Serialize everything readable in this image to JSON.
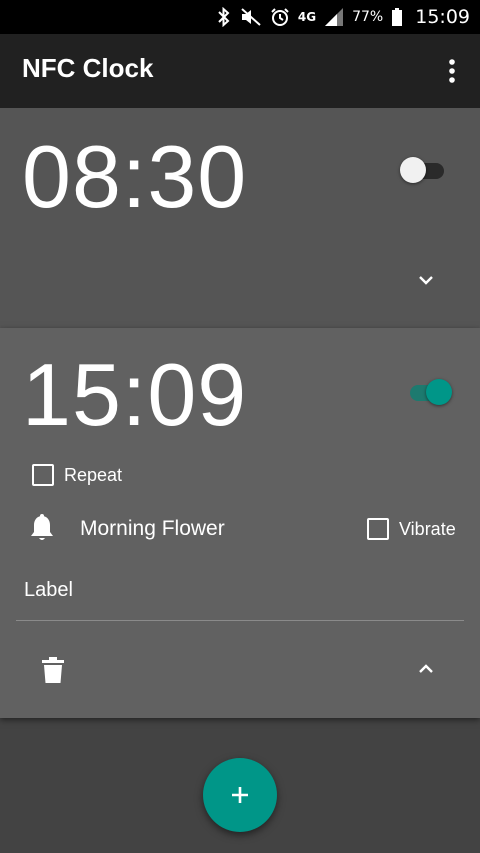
{
  "status_bar": {
    "network": "4G",
    "battery": "77%",
    "time": "15:09"
  },
  "app_bar": {
    "title": "NFC Clock"
  },
  "alarms": [
    {
      "time": "08:30",
      "enabled": false,
      "expanded": false
    },
    {
      "time": "15:09",
      "enabled": true,
      "expanded": true,
      "repeat_label": "Repeat",
      "repeat_checked": false,
      "ringtone": "Morning Flower",
      "vibrate_label": "Vibrate",
      "vibrate_checked": false,
      "label_text": "Label"
    }
  ],
  "colors": {
    "accent": "#009688",
    "toolbar": "#212121",
    "background": "#434343"
  },
  "icons": [
    "bluetooth-icon",
    "mute-icon",
    "alarm-icon",
    "signal-icon",
    "battery-icon",
    "overflow-menu-icon",
    "chevron-down-icon",
    "bell-icon",
    "trash-icon",
    "chevron-up-icon",
    "add-icon"
  ]
}
